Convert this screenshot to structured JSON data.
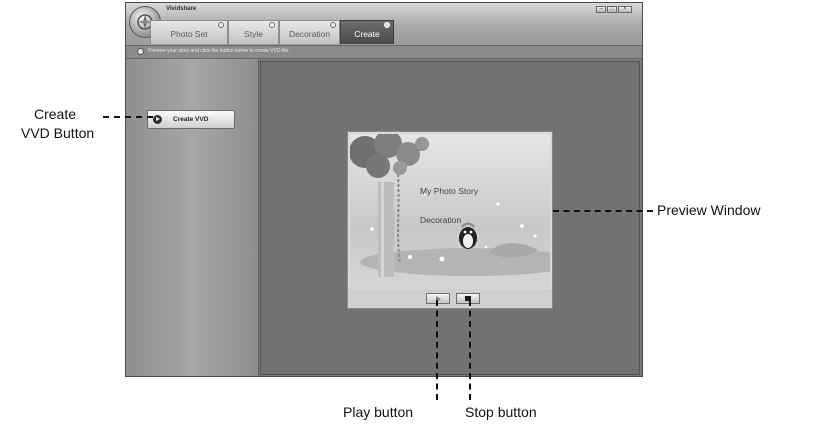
{
  "app": {
    "title": "Vividshare",
    "tabs": [
      {
        "label": "Photo Set",
        "selected": false
      },
      {
        "label": "Style",
        "selected": false
      },
      {
        "label": "Decoration",
        "selected": false
      },
      {
        "label": "Create",
        "selected": true
      }
    ],
    "window_controls": {
      "minimize": "–",
      "maximize": "□",
      "close": "×"
    },
    "instruction": "Preview your story and click the button below to create VVD file.",
    "create_button_label": "Create VVD"
  },
  "preview": {
    "story_title": "My Photo Story",
    "decoration_text": "Decoration",
    "controls": [
      "play",
      "stop"
    ]
  },
  "callouts": {
    "create_vvd_line1": "Create",
    "create_vvd_line2": "VVD Button",
    "preview_window": "Preview Window",
    "play_button": "Play button",
    "stop_button": "Stop button"
  },
  "icons": {
    "logo": "app-logo-icon",
    "info": "info-icon",
    "create": "play-circle-icon",
    "play": "play-icon",
    "stop": "stop-icon"
  }
}
